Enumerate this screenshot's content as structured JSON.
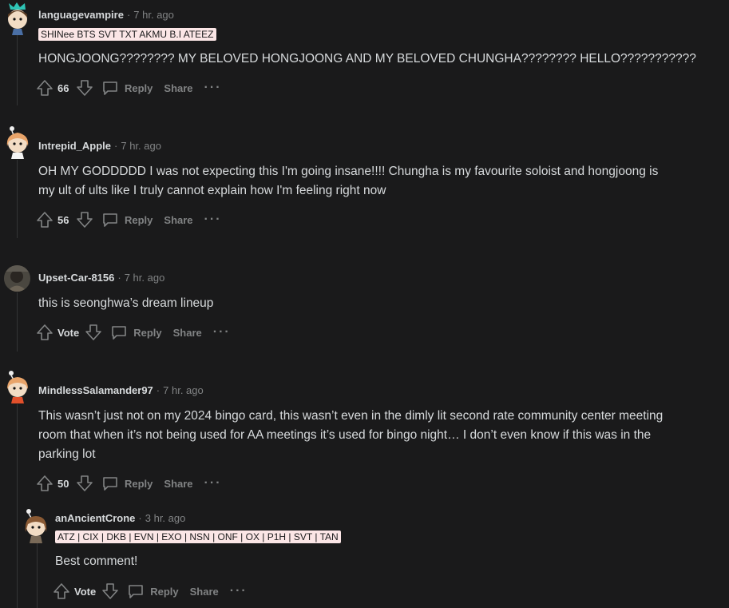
{
  "comments": [
    {
      "username": "languagevampire",
      "time": "7 hr. ago",
      "flair": "SHINee BTS SVT TXT AKMU B.I ATEEZ",
      "body": "HONGJOONG???????? MY BELOVED HONGJOONG AND MY BELOVED CHUNGHA???????? HELLO???????????",
      "score": "66",
      "reply_label": "Reply",
      "share_label": "Share",
      "more_label": "···"
    },
    {
      "username": "Intrepid_Apple",
      "time": "7 hr. ago",
      "body_line1": "OH MY GODDDDD I was not expecting this I'm going insane!!!! Chungha is my favourite soloist and hongjoong is",
      "body_line2": "my ult of ults like I truly cannot explain how I'm feeling right now",
      "score": "56",
      "reply_label": "Reply",
      "share_label": "Share",
      "more_label": "···"
    },
    {
      "username": "Upset-Car-8156",
      "time": "7 hr. ago",
      "body": "this is seonghwa’s dream lineup",
      "score": "Vote",
      "reply_label": "Reply",
      "share_label": "Share",
      "more_label": "···"
    },
    {
      "username": "MindlessSalamander97",
      "time": "7 hr. ago",
      "body_line1": "This wasn’t just not on my 2024 bingo card, this wasn’t even in the dimly lit second rate community center meeting",
      "body_line2": "room that when it’s not being used for AA meetings it’s used for bingo night… I don’t even know if this was in the",
      "body_line3": "parking lot",
      "score": "50",
      "reply_label": "Reply",
      "share_label": "Share",
      "more_label": "···"
    },
    {
      "username": "anAncientCrone",
      "time": "3 hr. ago",
      "flair": "ATZ | CIX | DKB | EVN | EXO | NSN | ONF | OX | P1H | SVT | TAN",
      "body": "Best comment!",
      "score": "Vote",
      "reply_label": "Reply",
      "share_label": "Share",
      "more_label": "···"
    }
  ],
  "colors": {
    "background": "#1a1a1b",
    "text": "#d7dadc",
    "muted": "#818384",
    "thread_line": "#343536",
    "flair_bg": "#fbe6e6"
  },
  "icons": [
    "upvote-icon",
    "downvote-icon",
    "comment-bubble-icon",
    "more-icon"
  ]
}
